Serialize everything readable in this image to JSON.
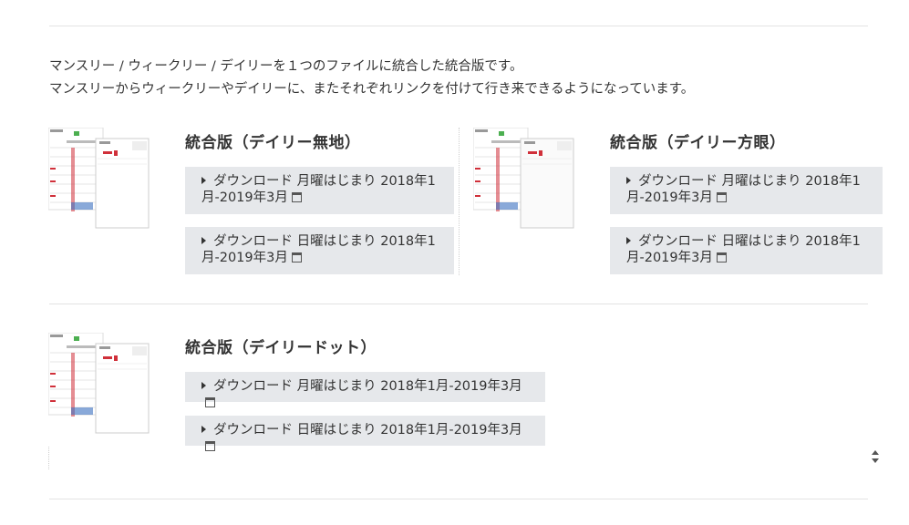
{
  "intro": {
    "line1": "マンスリー / ウィークリー / デイリーを１つのファイルに統合した統合版です。",
    "line2": "マンスリーからウィークリーやデイリーに、またそれぞれリンクを付けて行き来できるようになっています。"
  },
  "cards": {
    "plain": {
      "title": "統合版（デイリー無地）",
      "btn_monday": "ダウンロード 月曜はじまり 2018年1月-2019年3月",
      "btn_sunday": "ダウンロード 日曜はじまり 2018年1月-2019年3月"
    },
    "grid": {
      "title": "統合版（デイリー方眼）",
      "btn_monday": "ダウンロード 月曜はじまり 2018年1月-2019年3月",
      "btn_sunday": "ダウンロード 日曜はじまり 2018年1月-2019年3月"
    },
    "dot": {
      "title": "統合版（デイリードット）",
      "btn_monday": "ダウンロード 月曜はじまり 2018年1月-2019年3月",
      "btn_sunday": "ダウンロード 日曜はじまり 2018年1月-2019年3月"
    }
  },
  "colors": {
    "button_bg": "#e6e8eb",
    "accent_red": "#d0303a",
    "accent_green": "#4caf50",
    "accent_blue": "#3a6fc0"
  }
}
